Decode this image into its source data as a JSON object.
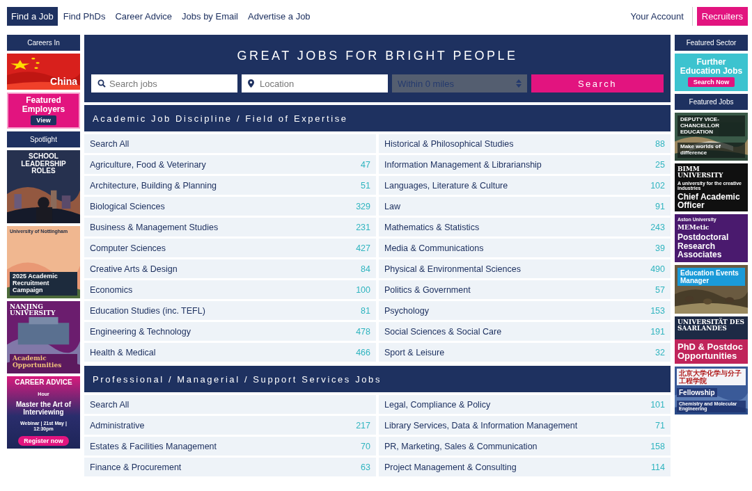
{
  "nav": {
    "items": [
      {
        "label": "Find a Job",
        "selected": true
      },
      {
        "label": "Find PhDs",
        "selected": false
      },
      {
        "label": "Career Advice",
        "selected": false
      },
      {
        "label": "Jobs by Email",
        "selected": false
      },
      {
        "label": "Advertise a Job",
        "selected": false
      }
    ],
    "account": "Your Account",
    "recruiters": "Recruiters"
  },
  "left_sidebar": [
    {
      "kind": "header",
      "label": "Careers In"
    },
    {
      "kind": "china",
      "texts": [
        {
          "kind": "title",
          "text": "China"
        }
      ]
    },
    {
      "kind": "pink",
      "texts": [
        {
          "kind": "title",
          "text": "Featured Employers"
        },
        {
          "kind": "button",
          "text": "View"
        }
      ]
    },
    {
      "kind": "header",
      "label": "Spotlight"
    },
    {
      "kind": "birmingham",
      "texts": [
        {
          "kind": "title",
          "text": "SCHOOL LEADERSHIP ROLES"
        }
      ]
    },
    {
      "kind": "nottingham",
      "texts": [
        {
          "kind": "small",
          "text": "University of Nottingham"
        },
        {
          "kind": "tag",
          "text": "2025 Academic Recruitment Campaign"
        }
      ]
    },
    {
      "kind": "nanjing",
      "texts": [
        {
          "kind": "serif",
          "text": "NANJING UNIVERSITY"
        },
        {
          "kind": "tag",
          "text": "Academic Opportunities"
        }
      ]
    },
    {
      "kind": "career",
      "texts": [
        {
          "kind": "title",
          "text": "CAREER ADVICE"
        },
        {
          "kind": "small",
          "text": "Hour"
        },
        {
          "kind": "title",
          "text": "Master the Art of Interviewing"
        },
        {
          "kind": "small",
          "text": "Webinar | 21st May | 12:30pm"
        },
        {
          "kind": "button",
          "text": "Register now"
        }
      ]
    }
  ],
  "hero": {
    "title": "GREAT JOBS FOR BRIGHT PEOPLE",
    "keywords_placeholder": "Search jobs",
    "location_placeholder": "Location",
    "distance": "Within 0 miles",
    "search_button": "Search"
  },
  "sections": [
    {
      "title": "Academic Job Discipline / Field of Expertise",
      "columns": [
        [
          {
            "name": "Search All"
          },
          {
            "name": "Agriculture, Food & Veterinary",
            "count": "47"
          },
          {
            "name": "Architecture, Building & Planning",
            "count": "51"
          },
          {
            "name": "Biological Sciences",
            "count": "329"
          },
          {
            "name": "Business & Management Studies",
            "count": "231"
          },
          {
            "name": "Computer Sciences",
            "count": "427"
          },
          {
            "name": "Creative Arts & Design",
            "count": "84"
          },
          {
            "name": "Economics",
            "count": "100"
          },
          {
            "name": "Education Studies (inc. TEFL)",
            "count": "81"
          },
          {
            "name": "Engineering & Technology",
            "count": "478"
          },
          {
            "name": "Health & Medical",
            "count": "466"
          }
        ],
        [
          {
            "name": "Historical & Philosophical Studies",
            "count": "88"
          },
          {
            "name": "Information Management & Librarianship",
            "count": "25"
          },
          {
            "name": "Languages, Literature & Culture",
            "count": "102"
          },
          {
            "name": "Law",
            "count": "91"
          },
          {
            "name": "Mathematics & Statistics",
            "count": "243"
          },
          {
            "name": "Media & Communications",
            "count": "39"
          },
          {
            "name": "Physical & Environmental Sciences",
            "count": "490"
          },
          {
            "name": "Politics & Government",
            "count": "57"
          },
          {
            "name": "Psychology",
            "count": "153"
          },
          {
            "name": "Social Sciences & Social Care",
            "count": "191"
          },
          {
            "name": "Sport & Leisure",
            "count": "32"
          }
        ]
      ]
    },
    {
      "title": "Professional / Managerial / Support Services Jobs",
      "columns": [
        [
          {
            "name": "Search All"
          },
          {
            "name": "Administrative",
            "count": "217"
          },
          {
            "name": "Estates & Facilities Management",
            "count": "70"
          },
          {
            "name": "Finance & Procurement",
            "count": "63"
          }
        ],
        [
          {
            "name": "Legal, Compliance & Policy",
            "count": "101"
          },
          {
            "name": "Library Services, Data & Information Management",
            "count": "71"
          },
          {
            "name": "PR, Marketing, Sales & Communication",
            "count": "158"
          },
          {
            "name": "Project Management & Consulting",
            "count": "114"
          }
        ]
      ]
    }
  ],
  "right_sidebar": [
    {
      "kind": "header",
      "label": "Featured Sector"
    },
    {
      "kind": "further",
      "texts": [
        {
          "kind": "title",
          "text": "Further Education Jobs"
        },
        {
          "kind": "button",
          "text": "Search Now"
        }
      ]
    },
    {
      "kind": "header",
      "label": "Featured Jobs"
    },
    {
      "kind": "deputy",
      "texts": [
        {
          "kind": "tag",
          "text": "DEPUTY VICE-CHANCELLOR EDUCATION"
        },
        {
          "kind": "tag",
          "text": "Make worlds of difference"
        }
      ]
    },
    {
      "kind": "bimm",
      "texts": [
        {
          "kind": "serif",
          "text": "BIMM UNIVERSITY"
        },
        {
          "kind": "small",
          "text": "A university for the creative industries"
        },
        {
          "kind": "title",
          "text": "Chief Academic Officer"
        }
      ]
    },
    {
      "kind": "aston",
      "texts": [
        {
          "kind": "small",
          "text": "Aston University"
        },
        {
          "kind": "serif",
          "text": "MEMetic"
        },
        {
          "kind": "title",
          "text": "Postdoctoral Research Associates"
        }
      ]
    },
    {
      "kind": "events",
      "texts": [
        {
          "kind": "tag",
          "text": "Education Events Manager"
        }
      ]
    },
    {
      "kind": "saarland",
      "texts": [
        {
          "kind": "serif",
          "text": "UNIVERSITÄT DES SAARLANDES"
        },
        {
          "kind": "title",
          "text": "PhD & Postdoc Opportunities"
        }
      ]
    },
    {
      "kind": "peking",
      "texts": [
        {
          "kind": "serif",
          "text": "北京大学化学与分子工程学院"
        },
        {
          "kind": "tag",
          "text": "Fellowship"
        },
        {
          "kind": "tag",
          "text": "Chemistry and Molecular Engineering"
        }
      ]
    }
  ]
}
